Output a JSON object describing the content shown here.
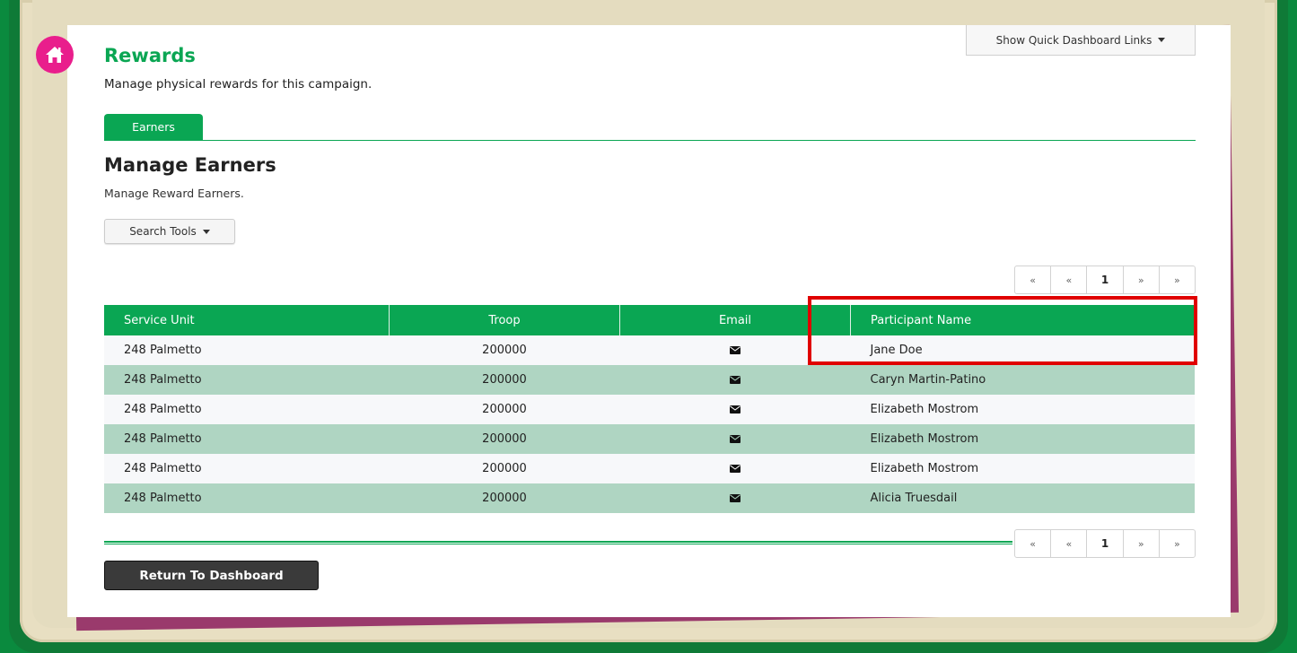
{
  "page": {
    "title": "Rewards",
    "subtitle": "Manage physical rewards for this campaign."
  },
  "quick_links": {
    "label": "Show Quick Dashboard Links"
  },
  "tabs": [
    {
      "label": "Earners",
      "active": true
    }
  ],
  "section": {
    "title": "Manage Earners",
    "description": "Manage Reward Earners."
  },
  "search_tools": {
    "label": "Search Tools"
  },
  "pagination": {
    "first": "«",
    "prev": "«",
    "current": "1",
    "next": "»",
    "last": "»"
  },
  "table": {
    "headers": [
      "Service Unit",
      "Troop",
      "Email",
      "Participant Name"
    ],
    "rows": [
      {
        "service_unit": "248 Palmetto",
        "troop": "200000",
        "participant": "Jane Doe"
      },
      {
        "service_unit": "248 Palmetto",
        "troop": "200000",
        "participant": "Caryn Martin-Patino"
      },
      {
        "service_unit": "248 Palmetto",
        "troop": "200000",
        "participant": "Elizabeth Mostrom"
      },
      {
        "service_unit": "248 Palmetto",
        "troop": "200000",
        "participant": "Elizabeth Mostrom"
      },
      {
        "service_unit": "248 Palmetto",
        "troop": "200000",
        "participant": "Elizabeth Mostrom"
      },
      {
        "service_unit": "248 Palmetto",
        "troop": "200000",
        "participant": "Alicia Truesdail"
      }
    ]
  },
  "return_button": {
    "label": "Return To Dashboard"
  },
  "colors": {
    "accent": "#0aa653",
    "row_alt": "#afd5c2",
    "home_icon": "#e91e8c",
    "highlight": "#e00000"
  },
  "icons": {
    "home": "home-icon",
    "email": "envelope-icon"
  }
}
